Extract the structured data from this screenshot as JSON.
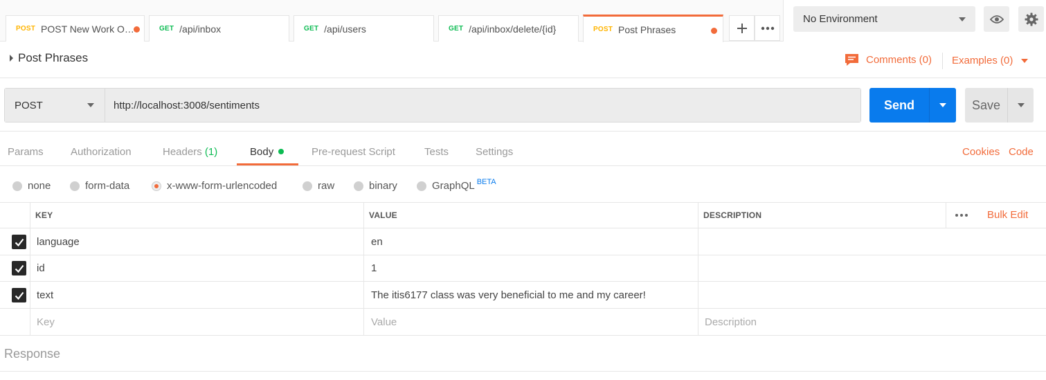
{
  "tabs": [
    {
      "method": "POST",
      "name": "POST New Work Or...",
      "unsaved": true
    },
    {
      "method": "GET",
      "name": "/api/inbox",
      "unsaved": false
    },
    {
      "method": "GET",
      "name": "/api/users",
      "unsaved": false
    },
    {
      "method": "GET",
      "name": "/api/inbox/delete/{id}",
      "unsaved": false
    },
    {
      "method": "POST",
      "name": "Post Phrases",
      "unsaved": true,
      "active": true
    }
  ],
  "environment": {
    "selected": "No Environment"
  },
  "request": {
    "title": "Post Phrases",
    "comments_label": "Comments (0)",
    "examples_label": "Examples (0)",
    "method": "POST",
    "url": "http://localhost:3008/sentiments",
    "send_label": "Send",
    "save_label": "Save"
  },
  "request_tabs": {
    "params": "Params",
    "authorization": "Authorization",
    "headers": "Headers",
    "headers_count": "(1)",
    "body": "Body",
    "prerequest": "Pre-request Script",
    "tests": "Tests",
    "settings": "Settings",
    "cookies": "Cookies",
    "code": "Code"
  },
  "body_types": {
    "none": "none",
    "form_data": "form-data",
    "urlencoded": "x-www-form-urlencoded",
    "raw": "raw",
    "binary": "binary",
    "graphql": "GraphQL",
    "graphql_badge": "BETA",
    "selected": "x-www-form-urlencoded"
  },
  "table": {
    "headers": {
      "key": "KEY",
      "value": "VALUE",
      "description": "DESCRIPTION"
    },
    "bulk_edit": "Bulk Edit",
    "rows": [
      {
        "key": "language",
        "value": "en",
        "description": "",
        "checked": true
      },
      {
        "key": "id",
        "value": "1",
        "description": "",
        "checked": true
      },
      {
        "key": "text",
        "value": "The itis6177 class was very beneficial to me and my career!",
        "description": "",
        "checked": true
      }
    ],
    "placeholders": {
      "key": "Key",
      "value": "Value",
      "description": "Description"
    }
  },
  "response": {
    "label": "Response"
  },
  "colors": {
    "accent": "#f26b3a",
    "send": "#097bed",
    "get": "#0cbb52",
    "post": "#ffb400"
  },
  "icons": [
    "plus-icon",
    "more-icon",
    "eye-icon",
    "gear-icon",
    "comment-icon",
    "checkbox-checked-icon",
    "caret-down-icon",
    "caret-right-icon"
  ]
}
